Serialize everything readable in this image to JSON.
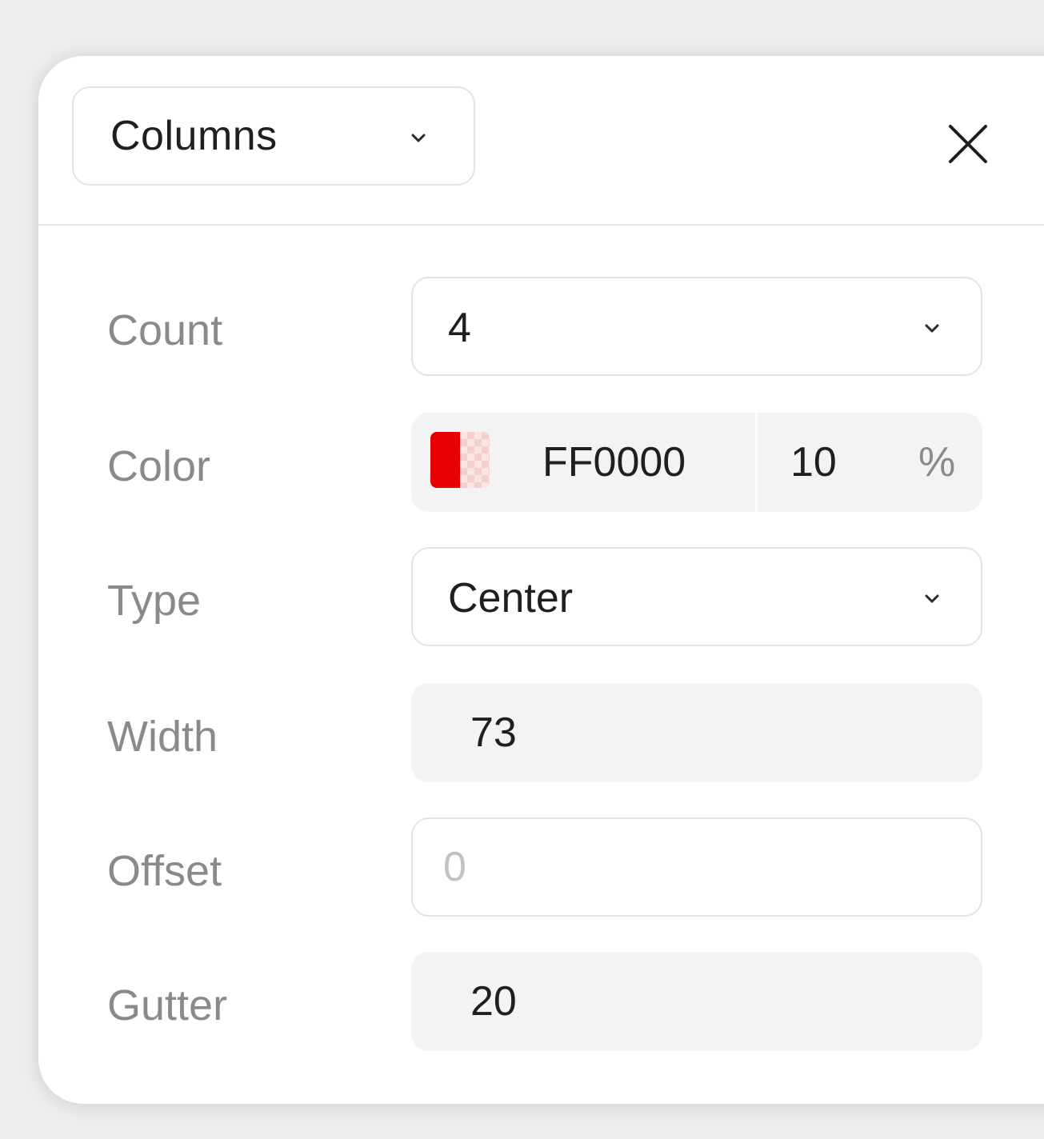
{
  "header": {
    "mode_select": {
      "value": "Columns"
    }
  },
  "fields": {
    "count": {
      "label": "Count",
      "value": "4"
    },
    "color": {
      "label": "Color",
      "hex": "FF0000",
      "opacity": "10",
      "unit": "%",
      "swatch_color": "#FF0000"
    },
    "type": {
      "label": "Type",
      "value": "Center"
    },
    "width": {
      "label": "Width",
      "value": "73"
    },
    "offset": {
      "label": "Offset",
      "placeholder": "0"
    },
    "gutter": {
      "label": "Gutter",
      "value": "20"
    }
  },
  "icons": {
    "close": "close-icon",
    "dropdown": "chevron-down-icon"
  }
}
